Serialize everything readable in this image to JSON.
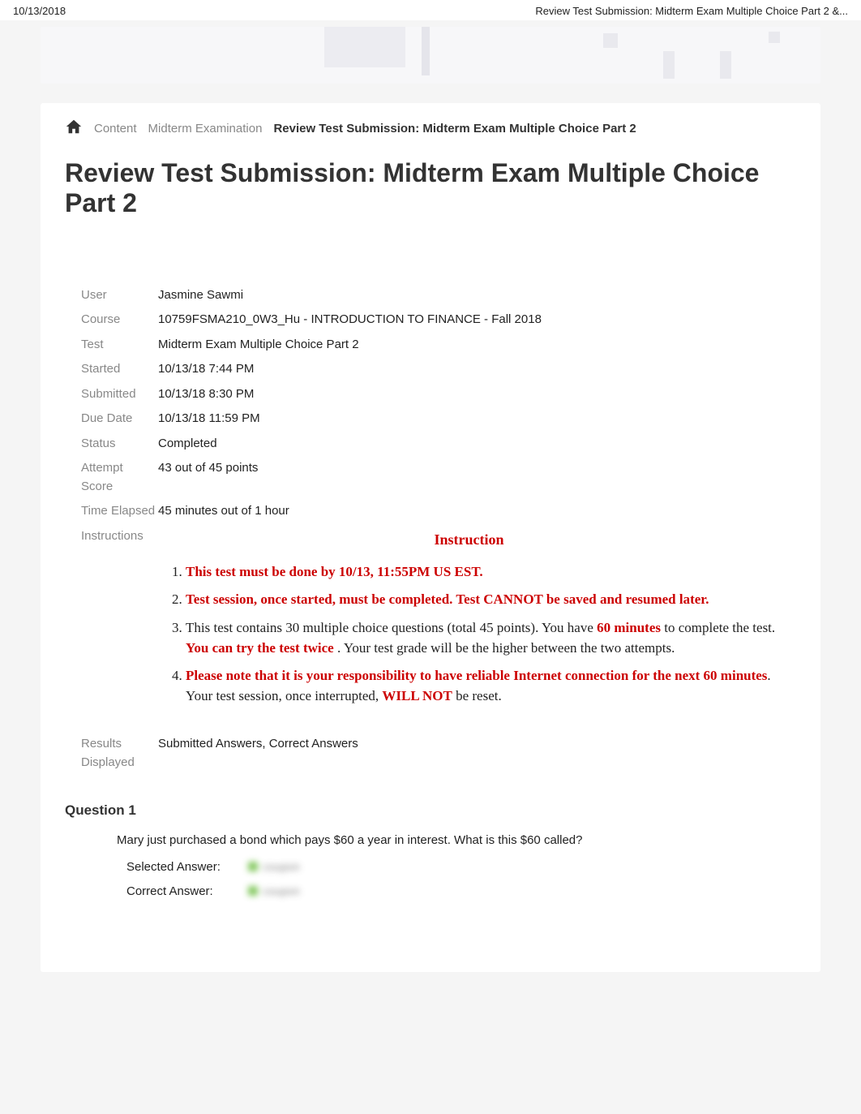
{
  "print_header": {
    "date": "10/13/2018",
    "title": "Review Test Submission: Midterm Exam Multiple Choice Part 2 &..."
  },
  "breadcrumb": {
    "content": "Content",
    "mid_exam": "Midterm Examination",
    "current": "Review Test Submission: Midterm Exam Multiple Choice Part 2"
  },
  "page_title": "Review Test Submission: Midterm Exam Multiple Choice Part 2",
  "info": {
    "user_label": "User",
    "user_value": "Jasmine Sawmi",
    "course_label": "Course",
    "course_value": "10759FSMA210_0W3_Hu - INTRODUCTION TO FINANCE - Fall 2018",
    "test_label": "Test",
    "test_value": "Midterm Exam Multiple Choice Part 2",
    "started_label": "Started",
    "started_value": "10/13/18 7:44 PM",
    "submitted_label": "Submitted",
    "submitted_value": "10/13/18 8:30 PM",
    "due_label": "Due Date",
    "due_value": "10/13/18 11:59 PM",
    "status_label": "Status",
    "status_value": "Completed",
    "attempt_label": "Attempt Score",
    "attempt_value": "43 out of 45 points",
    "time_label": "Time Elapsed",
    "time_value": "45 minutes out of 1 hour",
    "instructions_label": "Instructions",
    "results_label": "Results Displayed",
    "results_value": "Submitted Answers, Correct Answers"
  },
  "instructions": {
    "heading": "Instruction",
    "items": {
      "i1": "This test must be done by 10/13, 11:55PM US EST.",
      "i2": "Test session, once started, must be completed. Test CANNOT be saved and resumed later.",
      "i3_a": "This test contains 30 multiple choice questions (total 45 points). You have ",
      "i3_b": "60 minutes",
      "i3_c": " to complete the test. ",
      "i3_d": "You can try the test twice",
      "i3_e": " . Your test grade will be the higher between the two attempts.",
      "i4_a": "Please note that it is your responsibility to have reliable Internet connection for the next 60 minutes",
      "i4_b": ". Your test session, once interrupted, ",
      "i4_c": "WILL NOT",
      "i4_d": " be reset."
    }
  },
  "question": {
    "title": "Question 1",
    "text": "Mary just purchased a bond which pays $60 a year in interest. What is this $60 called?",
    "selected_label": "Selected Answer:",
    "correct_label": "Correct Answer:",
    "hidden_text": "coupon"
  }
}
